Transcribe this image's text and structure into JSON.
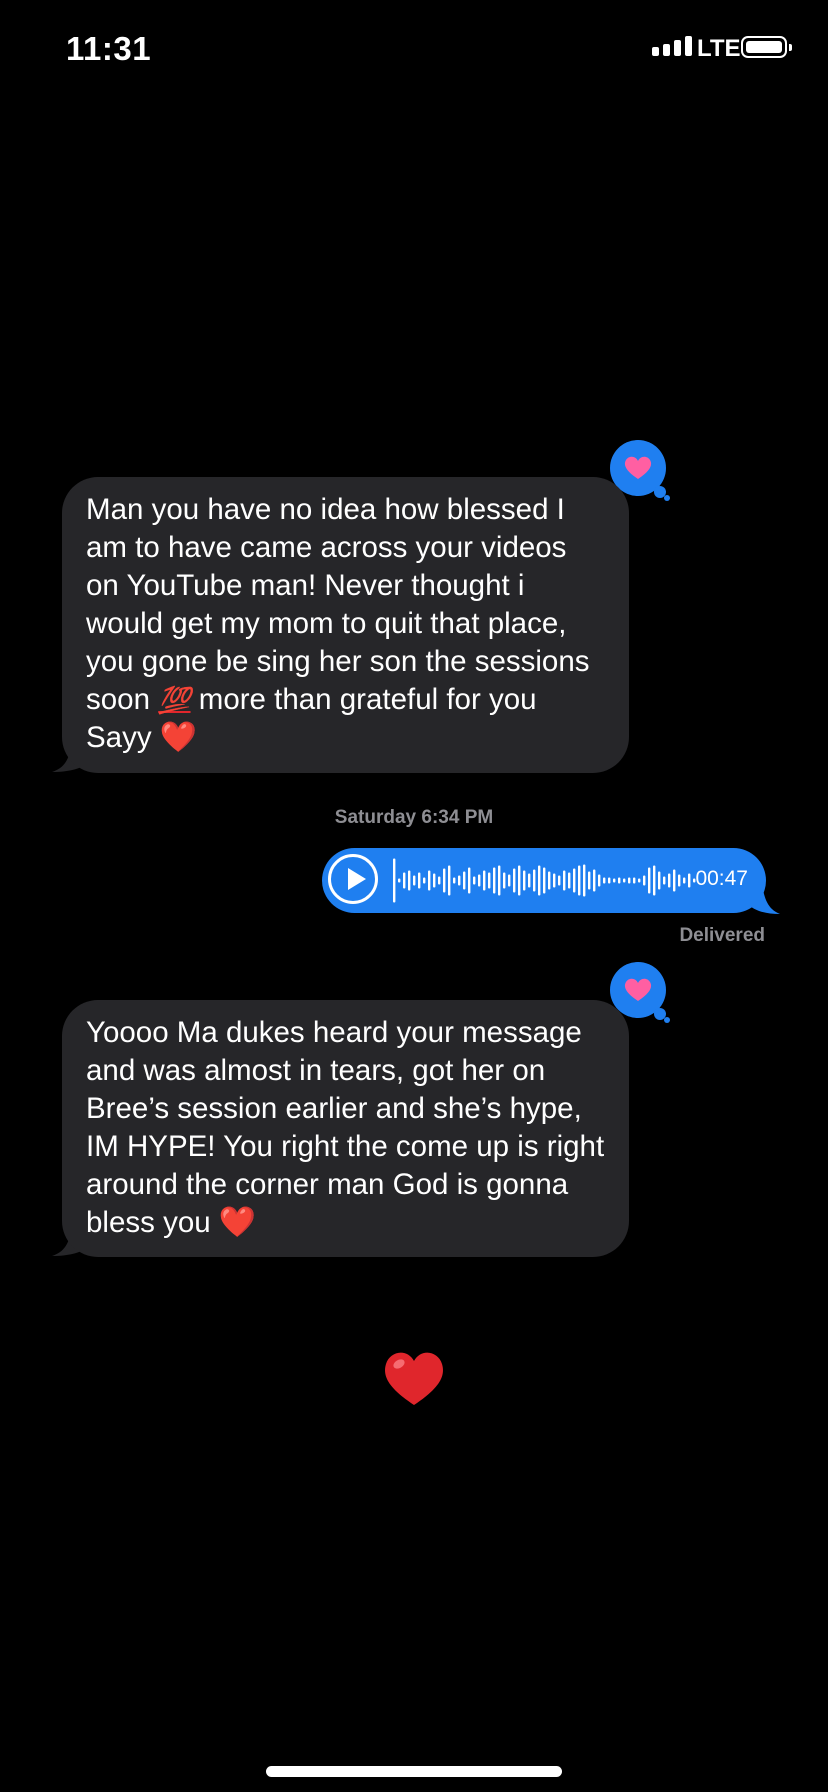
{
  "status_bar": {
    "time": "11:31",
    "network": "LTE",
    "battery_level": 1.0
  },
  "messages": [
    {
      "direction": "incoming",
      "text_before_100": "Man you have no idea how blessed I am to have came across your videos on YouTube man! Never thought i would get my mom to quit that place, you gone be sing her son the sessions soon ",
      "emoji_100": "💯",
      "text_after_100": " more than grateful for you Sayy ",
      "emoji_heart": "❤️",
      "reaction": "heart"
    },
    {
      "direction": "incoming",
      "text": "Yoooo Ma dukes heard your message and was almost in tears, got her on Bree’s session earlier and she’s hype, IM HYPE! You right the come up is right around the corner man God is gonna bless you ",
      "emoji_heart": "❤️",
      "reaction": "heart"
    }
  ],
  "timestamp": "Saturday 6:34 PM",
  "audio_message": {
    "direction": "outgoing",
    "duration": "00:47",
    "status": "Delivered"
  },
  "big_emoji": "heart",
  "colors": {
    "background": "#000000",
    "incoming_bubble": "#262629",
    "outgoing_bubble": "#1f7ff0",
    "reaction_heart": "#ff5fa2",
    "heart": "#e0262c",
    "meta_text": "#8e8e93"
  }
}
